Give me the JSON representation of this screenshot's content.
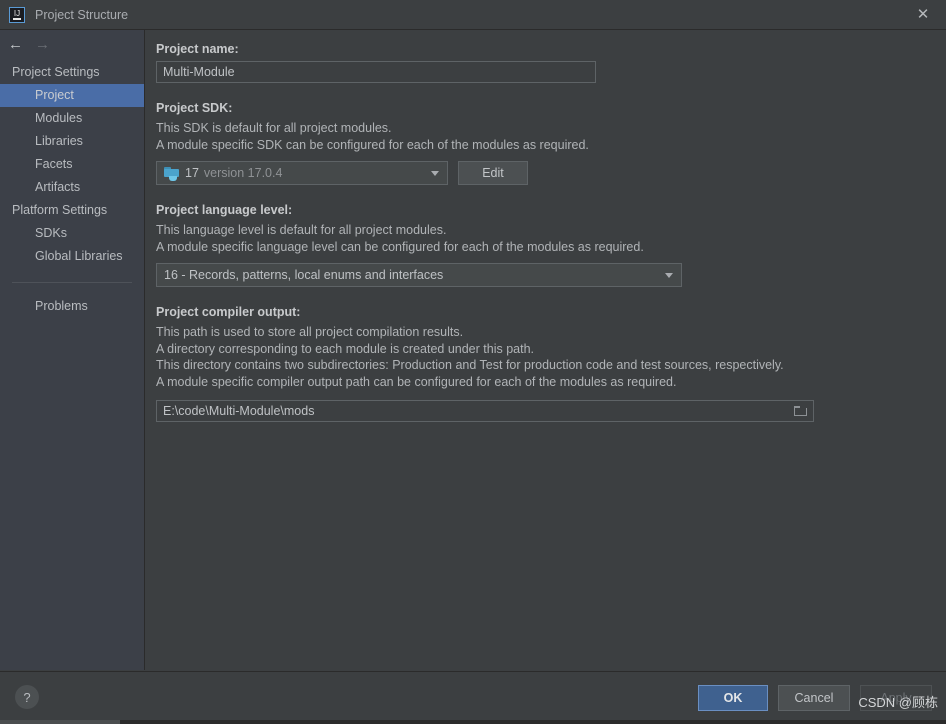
{
  "window": {
    "title": "Project Structure",
    "app_icon": "intellij-idea-icon",
    "close_label": "✕"
  },
  "navigation": {
    "back_icon": "←",
    "forward_icon": "→"
  },
  "sidebar": {
    "groups": [
      {
        "label": "Project Settings",
        "items": [
          {
            "label": "Project",
            "selected": true
          },
          {
            "label": "Modules",
            "selected": false
          },
          {
            "label": "Libraries",
            "selected": false
          },
          {
            "label": "Facets",
            "selected": false
          },
          {
            "label": "Artifacts",
            "selected": false
          }
        ]
      },
      {
        "label": "Platform Settings",
        "items": [
          {
            "label": "SDKs",
            "selected": false
          },
          {
            "label": "Global Libraries",
            "selected": false
          }
        ]
      }
    ],
    "problems": {
      "label": "Problems"
    }
  },
  "project_name": {
    "label": "Project name:",
    "value": "Multi-Module"
  },
  "project_sdk": {
    "label": "Project SDK:",
    "description_lines": [
      "This SDK is default for all project modules.",
      "A module specific SDK can be configured for each of the modules as required."
    ],
    "selected_name": "17",
    "selected_version": "version 17.0.4",
    "icon": "java-sdk-folder-icon",
    "edit_button": "Edit"
  },
  "language_level": {
    "label": "Project language level:",
    "description_lines": [
      "This language level is default for all project modules.",
      "A module specific language level can be configured for each of the modules as required."
    ],
    "selected": "16 - Records, patterns, local enums and interfaces"
  },
  "compiler_output": {
    "label": "Project compiler output:",
    "description_lines": [
      "This path is used to store all project compilation results.",
      "A directory corresponding to each module is created under this path.",
      "This directory contains two subdirectories: Production and Test for production code and test sources, respectively.",
      "A module specific compiler output path can be configured for each of the modules as required."
    ],
    "path": "E:\\code\\Multi-Module\\mods",
    "browse_icon": "folder-browse-icon"
  },
  "footer": {
    "help_label": "?",
    "ok_label": "OK",
    "cancel_label": "Cancel",
    "apply_label": "Apply"
  },
  "watermark": {
    "text": "CSDN @顾栋"
  },
  "colors": {
    "accent_selection": "#4a6da7",
    "ok_button": "#3f618f",
    "sidebar_bg": "#3c4048",
    "panel_bg": "#3c3f41",
    "sdk_icon": "#4ba3cc"
  }
}
